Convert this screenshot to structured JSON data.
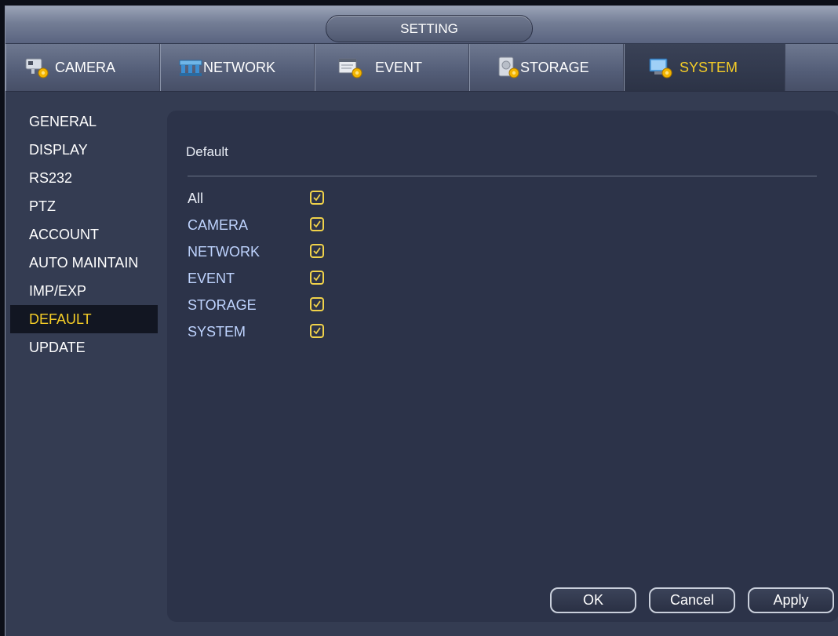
{
  "window": {
    "title": "SETTING"
  },
  "tabs": [
    {
      "label": "CAMERA",
      "icon": "camera-settings-icon",
      "active": false
    },
    {
      "label": "NETWORK",
      "icon": "network-settings-icon",
      "active": false
    },
    {
      "label": "EVENT",
      "icon": "event-settings-icon",
      "active": false
    },
    {
      "label": "STORAGE",
      "icon": "storage-settings-icon",
      "active": false
    },
    {
      "label": "SYSTEM",
      "icon": "system-settings-icon",
      "active": true
    }
  ],
  "sidebar": {
    "items": [
      {
        "label": "GENERAL"
      },
      {
        "label": "DISPLAY"
      },
      {
        "label": "RS232"
      },
      {
        "label": "PTZ"
      },
      {
        "label": "ACCOUNT"
      },
      {
        "label": "AUTO MAINTAIN"
      },
      {
        "label": "IMP/EXP"
      },
      {
        "label": "DEFAULT",
        "active": true
      },
      {
        "label": "UPDATE"
      }
    ]
  },
  "panel": {
    "title": "Default",
    "options": [
      {
        "label": "All",
        "checked": true
      },
      {
        "label": "CAMERA",
        "checked": true
      },
      {
        "label": "NETWORK",
        "checked": true
      },
      {
        "label": "EVENT",
        "checked": true
      },
      {
        "label": "STORAGE",
        "checked": true
      },
      {
        "label": "SYSTEM",
        "checked": true
      }
    ]
  },
  "buttons": {
    "ok": "OK",
    "cancel": "Cancel",
    "apply": "Apply"
  },
  "colors": {
    "accent": "#f5cd27",
    "background": "#343c52",
    "panel": "#2c3349",
    "option_label": "#bfd4ff"
  }
}
